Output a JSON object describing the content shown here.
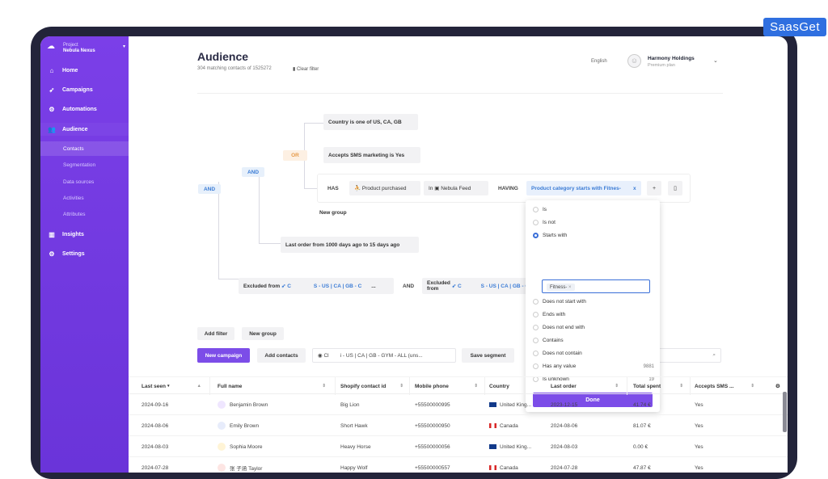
{
  "brand": "SaasGet",
  "sidebar": {
    "project_label": "Project",
    "project_name": "Nebula Nexus",
    "items": [
      {
        "label": "Home",
        "icon": "home-icon"
      },
      {
        "label": "Campaigns",
        "icon": "rocket-icon"
      },
      {
        "label": "Automations",
        "icon": "robot-icon"
      },
      {
        "label": "Audience",
        "icon": "users-icon"
      },
      {
        "label": "Insights",
        "icon": "bar-chart-icon"
      },
      {
        "label": "Settings",
        "icon": "gear-icon"
      }
    ],
    "subitems": [
      "Contacts",
      "Segmentation",
      "Data sources",
      "Activities",
      "Attributes"
    ]
  },
  "header": {
    "title": "Audience",
    "matching": "304 matching contacts of 1525272",
    "clear_filter": "Clear filter",
    "language": "English",
    "account_name": "Harmony Holdings",
    "account_plan": "Premium plan"
  },
  "filters": {
    "and_root": "AND",
    "and_inner": "AND",
    "or_label": "OR",
    "country_rule": "Country is one of US, CA, GB",
    "sms_rule": "Accepts SMS marketing is Yes",
    "has": "HAS",
    "event": "Product purchased",
    "in": "In",
    "source": "Nebula Feed",
    "having": "HAVING",
    "condition": "Product category starts with Fitnes-",
    "condition_x": "x",
    "new_group": "New group",
    "last_order_rule": "Last order from 1000 days ago to 15 days ago",
    "excluded1_prefix": "Excluded from",
    "excluded1_c": "C",
    "excluded1_tail": "S - US | CA | GB - C",
    "excluded1_more": "...",
    "and_between": "AND",
    "excluded2_prefix": "Excluded from",
    "excluded2_c": "C",
    "excluded2_tail": "S - US | CA | GB - C"
  },
  "dropdown": {
    "options": [
      {
        "label": "Is",
        "count": ""
      },
      {
        "label": "Is not",
        "count": ""
      },
      {
        "label": "Starts with",
        "count": ""
      },
      {
        "label": "Does not start with",
        "count": ""
      },
      {
        "label": "Ends with",
        "count": ""
      },
      {
        "label": "Does not end with",
        "count": ""
      },
      {
        "label": "Contains",
        "count": ""
      },
      {
        "label": "Does not contain",
        "count": ""
      },
      {
        "label": "Has any value",
        "count": "9881"
      },
      {
        "label": "Is unknown",
        "count": "19"
      }
    ],
    "selected": "Starts with",
    "input_chip": "Fitness-",
    "input_chip_x": "×",
    "done": "Done"
  },
  "actions": {
    "add_filter": "Add filter",
    "new_group": "New group",
    "new_campaign": "New campaign",
    "add_contacts": "Add contacts",
    "segment_value": "i - US | CA | GB - GYM - ALL (uns...",
    "segment_prefix": "Cl",
    "save_segment": "Save segment"
  },
  "table": {
    "columns": [
      "Last seen",
      "Full name",
      "Shopify contact id",
      "Mobile phone",
      "Country",
      "Last order",
      "Total spent",
      "Accepts SMS ..."
    ],
    "rows": [
      {
        "last_seen": "2024-09-16",
        "name": "Benjamin Brown",
        "shopify": "Big Lion",
        "phone": "+55500000995",
        "country": "United King...",
        "flag": "uk",
        "last_order": "2023-12-15",
        "spent": "41.74 €",
        "sms": "Yes",
        "avatar_color": "#efe6ff"
      },
      {
        "last_seen": "2024-08-06",
        "name": "Emily Brown",
        "shopify": "Short Hawk",
        "phone": "+55500000950",
        "country": "Canada",
        "flag": "ca",
        "last_order": "2024-08-06",
        "spent": "81.07 €",
        "sms": "Yes",
        "avatar_color": "#e7ecfb"
      },
      {
        "last_seen": "2024-08-03",
        "name": "Sophia Moore",
        "shopify": "Heavy Horse",
        "phone": "+55500000056",
        "country": "United King...",
        "flag": "uk",
        "last_order": "2024-08-03",
        "spent": "0.00 €",
        "sms": "Yes",
        "avatar_color": "#fff4d6"
      },
      {
        "last_seen": "2024-07-28",
        "name": "张 子涵 Taylor",
        "shopify": "Happy Wolf",
        "phone": "+55500000557",
        "country": "Canada",
        "flag": "ca",
        "last_order": "2024-07-28",
        "spent": "47.87 €",
        "sms": "Yes",
        "avatar_color": "#fde5e3"
      }
    ]
  }
}
